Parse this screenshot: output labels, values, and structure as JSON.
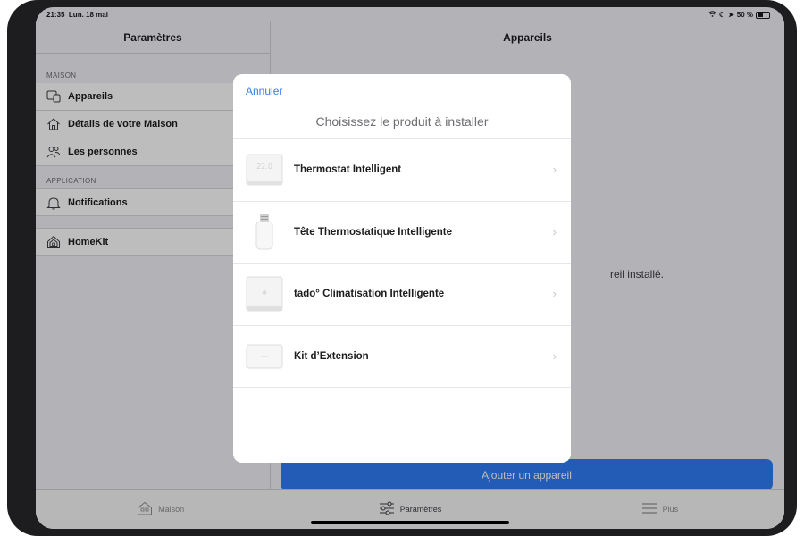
{
  "status_bar": {
    "time": "21:35",
    "date": "Lun. 18 mai",
    "battery": "50 %",
    "battery_level": 0.5
  },
  "sidebar": {
    "title": "Paramètres",
    "sections": [
      {
        "header": "MAISON",
        "items": [
          {
            "label": "Appareils",
            "icon": "devices-icon"
          },
          {
            "label": "Détails de votre Maison",
            "icon": "house-icon"
          },
          {
            "label": "Les personnes",
            "icon": "people-icon"
          }
        ]
      },
      {
        "header": "APPLICATION",
        "items": [
          {
            "label": "Notifications",
            "icon": "bell-icon"
          }
        ]
      }
    ],
    "homekit": {
      "label": "HomeKit",
      "icon": "homekit-icon"
    }
  },
  "main": {
    "title": "Appareils",
    "empty_message": "reil installé.",
    "add_button": "Ajouter un appareil"
  },
  "tabbar": {
    "tabs": [
      {
        "label": "Maison",
        "icon": "home-tab-icon",
        "active": false
      },
      {
        "label": "Paramètres",
        "icon": "sliders-icon",
        "active": true
      },
      {
        "label": "Plus",
        "icon": "menu-icon",
        "active": false
      }
    ]
  },
  "modal": {
    "cancel": "Annuler",
    "title": "Choisissez le produit à installer",
    "products": [
      {
        "label": "Thermostat Intelligent",
        "icon": "thermostat-icon",
        "display": "22.0"
      },
      {
        "label": "Tête Thermostatique Intelligente",
        "icon": "radiator-valve-icon"
      },
      {
        "label": "tado° Climatisation Intelligente",
        "icon": "ac-control-icon"
      },
      {
        "label": "Kit d’Extension",
        "icon": "extension-kit-icon"
      }
    ]
  },
  "colors": {
    "accent": "#2f7cf6",
    "background": "#f2f2f7"
  }
}
